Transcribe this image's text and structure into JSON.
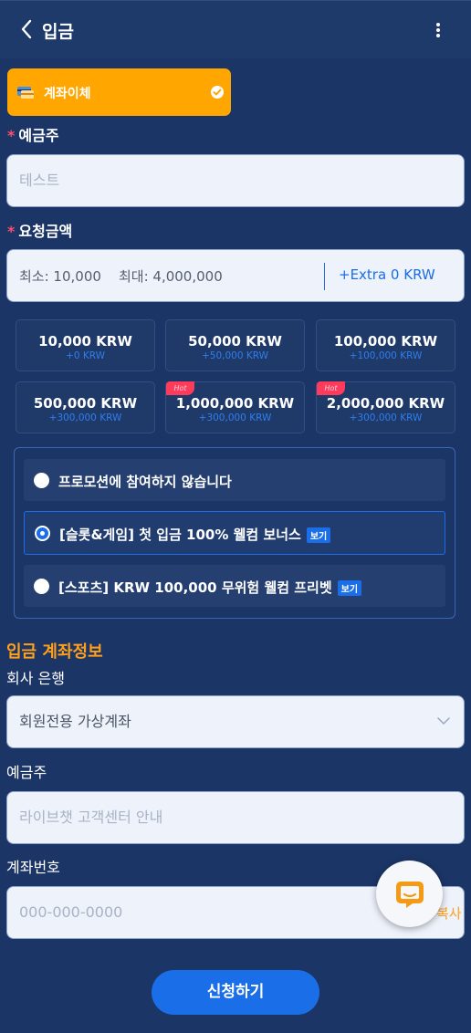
{
  "header": {
    "title": "입금",
    "back_icon": "chevron-left-icon",
    "menu_icon": "more-vertical-icon"
  },
  "method": {
    "label": "계좌이체",
    "icon": "bank-card-icon",
    "check_icon": "check-circle-icon",
    "color": "#ffa600"
  },
  "depositor": {
    "label": "예금주",
    "placeholder": "테스트"
  },
  "request_amount": {
    "label": "요청금액",
    "min_max": "최소: 10,000    최대: 4,000,000",
    "extra": "+Extra 0 KRW"
  },
  "amount_chips": [
    {
      "amount": "10,000 KRW",
      "bonus": "+0 KRW",
      "hot": false
    },
    {
      "amount": "50,000 KRW",
      "bonus": "+50,000 KRW",
      "hot": false
    },
    {
      "amount": "100,000 KRW",
      "bonus": "+100,000 KRW",
      "hot": false
    },
    {
      "amount": "500,000 KRW",
      "bonus": "+300,000 KRW",
      "hot": false
    },
    {
      "amount": "1,000,000 KRW",
      "bonus": "+300,000 KRW",
      "hot": true
    },
    {
      "amount": "2,000,000 KRW",
      "bonus": "+300,000 KRW",
      "hot": true
    }
  ],
  "hot_label": "Hot",
  "promotions": [
    {
      "text": "프로모션에 참여하지 않습니다",
      "selected": false,
      "badge": ""
    },
    {
      "text": "[슬롯&게임] 첫 입금 100% 웰컴 보너스",
      "selected": true,
      "badge": "보기"
    },
    {
      "text": "[스포츠] KRW 100,000 무위험 웰컴 프리벳",
      "selected": false,
      "badge": "보기"
    }
  ],
  "deposit_info": {
    "title": "입금 계좌정보",
    "bank_label": "회사 은행",
    "bank_value": "회원전용 가상계좌",
    "holder_label": "예금주",
    "holder_placeholder": "라이브챗 고객센터 안내",
    "account_label": "계좌번호",
    "account_placeholder": "000-000-0000",
    "copy_label": "복사"
  },
  "submit_label": "신청하기",
  "colors": {
    "accent": "#1a6ee8",
    "orange": "#ff9f1a",
    "background": "#1b3566"
  }
}
